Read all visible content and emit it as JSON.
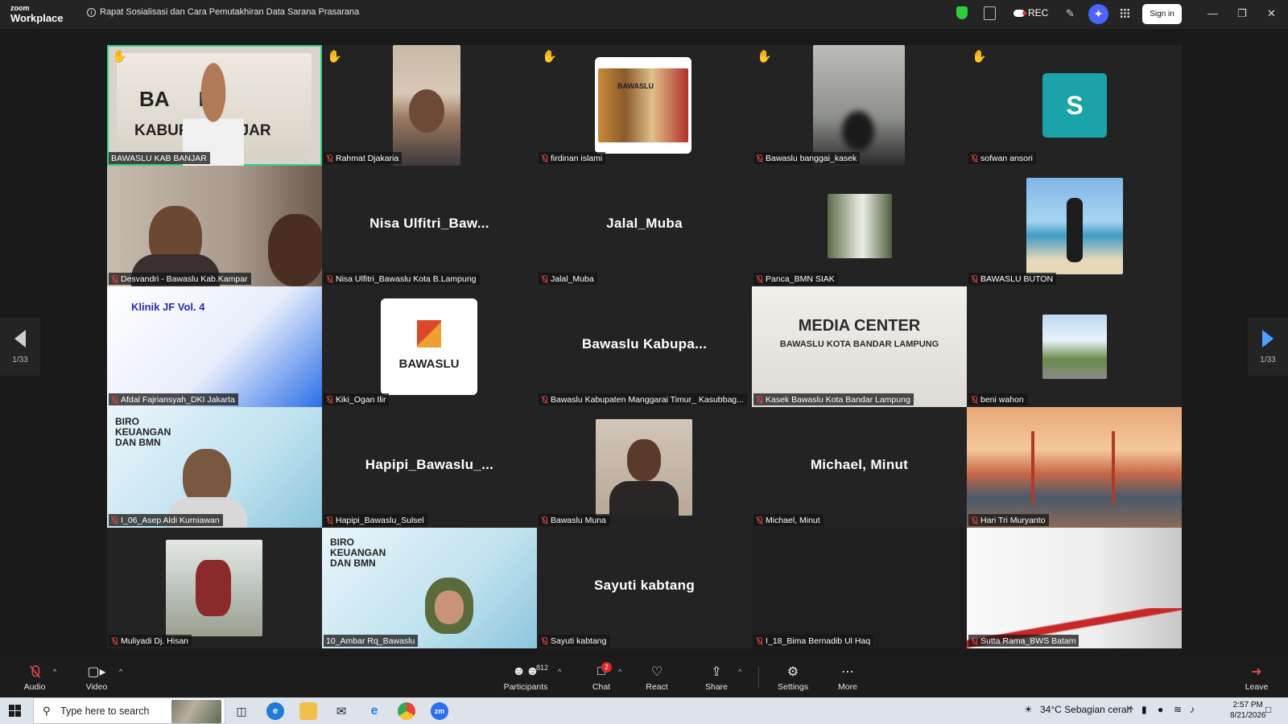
{
  "titlebar": {
    "logo_small": "zoom",
    "logo_big": "Workplace",
    "meeting_title": "Rapat Sosialisasi dan Cara Pemutakhiran Data Sarana Prasarana",
    "rec_label": "REC",
    "sign_in": "Sign in"
  },
  "pager": {
    "left_label": "1/33",
    "right_label": "1/33"
  },
  "tiles": [
    {
      "name": "BAWASLU KAB BANJAR",
      "hand": true,
      "type": "video",
      "big": ""
    },
    {
      "name": "Rahmat Djakaria",
      "hand": true,
      "type": "photo",
      "big": ""
    },
    {
      "name": "firdinan islami",
      "hand": true,
      "type": "photo",
      "big": ""
    },
    {
      "name": "Bawaslu banggai_kasek",
      "hand": true,
      "type": "photo",
      "big": ""
    },
    {
      "name": "sofwan ansori",
      "hand": true,
      "type": "avatar",
      "big": "S"
    },
    {
      "name": "Desvandri - Bawaslu Kab.Kampar",
      "hand": false,
      "type": "video",
      "big": ""
    },
    {
      "name": "Nisa Ulfitri_Bawaslu Kota B.Lampung",
      "hand": false,
      "type": "text",
      "big": "Nisa Ulfitri_Baw..."
    },
    {
      "name": "Jalal_Muba",
      "hand": false,
      "type": "text",
      "big": "Jalal_Muba"
    },
    {
      "name": "Panca_BMN SIAK",
      "hand": false,
      "type": "photo",
      "big": ""
    },
    {
      "name": "BAWASLU BUTON",
      "hand": false,
      "type": "photo",
      "big": ""
    },
    {
      "name": "Afdal Fajriansyah_DKI Jakarta",
      "hand": false,
      "type": "video",
      "big": "Klinik JF Vol. 4"
    },
    {
      "name": "Kiki_Ogan Ilir",
      "hand": false,
      "type": "logo",
      "big": "BAWASLU"
    },
    {
      "name": "Bawaslu Kabupaten Manggarai Timur_ Kasubbag...",
      "hand": false,
      "type": "text",
      "big": "Bawaslu Kabupa..."
    },
    {
      "name": "Kasek Bawaslu Kota Bandar Lampung",
      "hand": false,
      "type": "video",
      "big": "MEDIA CENTER"
    },
    {
      "name": "beni wahon",
      "hand": false,
      "type": "photo",
      "big": ""
    },
    {
      "name": "I_06_Asep Aldi Kurniawan",
      "hand": false,
      "type": "video",
      "big": "BIRO KEUANGAN DAN BMN"
    },
    {
      "name": "Hapipi_Bawaslu_Sulsel",
      "hand": false,
      "type": "text",
      "big": "Hapipi_Bawaslu_..."
    },
    {
      "name": "Bawaslu Muna",
      "hand": false,
      "type": "photo",
      "big": ""
    },
    {
      "name": "Michael, Minut",
      "hand": false,
      "type": "text",
      "big": "Michael, Minut"
    },
    {
      "name": "Hari Tri Muryanto",
      "hand": false,
      "type": "video",
      "big": ""
    },
    {
      "name": "Muliyadi Dj. Hisan",
      "hand": false,
      "type": "photo",
      "big": ""
    },
    {
      "name": "10_Ambar Rq_Bawaslu",
      "hand": false,
      "type": "video",
      "big": "BIRO KEUANGAN DAN BMN"
    },
    {
      "name": "Sayuti kabtang",
      "hand": false,
      "type": "text",
      "big": "Sayuti kabtang"
    },
    {
      "name": "I_18_Bima Bernadib Ul Haq",
      "hand": false,
      "type": "blank",
      "big": ""
    },
    {
      "name": "Sutta Rama_BWS Batam",
      "hand": false,
      "type": "video",
      "big": ""
    }
  ],
  "controls": {
    "audio": "Audio",
    "video": "Video",
    "participants": "Participants",
    "participants_count": "812",
    "chat": "Chat",
    "chat_badge": "2",
    "react": "React",
    "share": "Share",
    "settings": "Settings",
    "more": "More",
    "leave": "Leave"
  },
  "taskbar": {
    "search_placeholder": "Type here to search",
    "weather": "34°C  Sebagian cerah",
    "time": "2:57 PM",
    "date": "8/21/2026"
  },
  "colors": {
    "active_border": "#2fd27e",
    "raised_hand": "#f2b53a",
    "mic_muted": "#e04646",
    "avatar_teal": "#1aa3a8"
  }
}
